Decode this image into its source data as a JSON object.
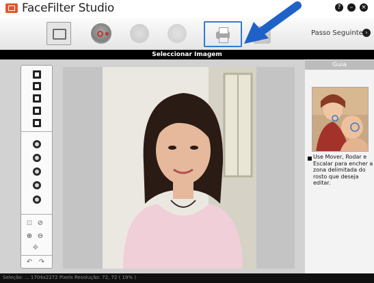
{
  "app": {
    "title": "FaceFilter Studio"
  },
  "window": {
    "help_button": "?",
    "minimize_button": "–",
    "close_button": "×"
  },
  "toolbar": {
    "steps": [
      {
        "icon": "image-step-icon",
        "state": "done"
      },
      {
        "icon": "face-effects-step-icon",
        "state": "active"
      },
      {
        "icon": "face-step-icon",
        "state": "disabled"
      },
      {
        "icon": "face-step-icon",
        "state": "disabled"
      },
      {
        "icon": "print-step-icon",
        "state": "highlighted"
      },
      {
        "icon": "final-step-icon",
        "state": "disabled"
      }
    ],
    "next_label": "Passo Seguinte",
    "next_icon": "›"
  },
  "header": {
    "title": "Seleccionar Imagem"
  },
  "guide": {
    "title": "Guia",
    "text": "Use Mover, Rodar e Escalar para encher a zona delimitada do rosto que deseja editar."
  },
  "tools": [
    "rotate-left-icon",
    "crop-icon",
    "copy-icon",
    "flip-icon",
    "mirror-icon",
    "effect-1-icon",
    "effect-2-icon",
    "effect-3-icon",
    "effect-4-icon",
    "effect-5-icon",
    "fit-icon",
    "no-icon",
    "zoom-in-icon",
    "zoom-out-icon",
    "move-icon",
    "undo-icon",
    "redo-icon"
  ],
  "tool_glyphs": {
    "zoom_in": "⊕",
    "zoom_out": "⊖",
    "no": "⊘",
    "fit": "⊡",
    "move": "✥",
    "undo": "↶",
    "redo": "↷"
  },
  "status": {
    "text": "Seleção: ... 1704x2272 Pixels   Resolução: 72, 72 ( 19% )"
  },
  "colors": {
    "highlight": "#2e7bd0",
    "arrow": "#1e62c8",
    "accent_red": "#e2572a"
  }
}
